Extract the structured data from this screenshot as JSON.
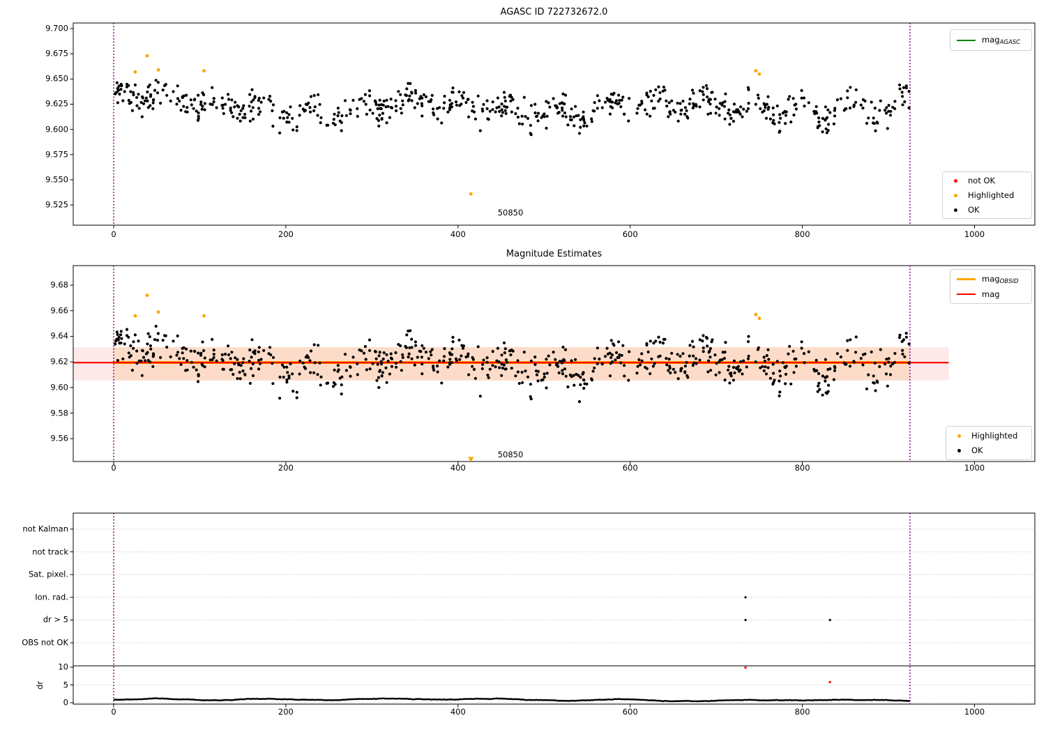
{
  "colors": {
    "ok": "#000000",
    "highlighted": "#ffa500",
    "not_ok": "#ff0000",
    "mag_line": "#ff0000",
    "obsid_line": "#ffa500",
    "agasc_line": "#008000",
    "vline": "#800080",
    "band_outer": "#fde9e9",
    "band_inner": "#fcdcc9",
    "grid": "#b5b5b5"
  },
  "legend1": {
    "line_label": "mag",
    "line_sub": "AGASC",
    "items": [
      {
        "label": "not OK",
        "color": "#ff0000"
      },
      {
        "label": "Highlighted",
        "color": "#ffa500"
      },
      {
        "label": "OK",
        "color": "#000000"
      }
    ]
  },
  "legend2": {
    "line1_label": "mag",
    "line1_sub": "OBSID",
    "line1_color": "#ffa500",
    "line2_label": "mag",
    "line2_color": "#ff0000",
    "items": [
      {
        "label": "Highlighted",
        "color": "#ffa500"
      },
      {
        "label": "OK",
        "color": "#000000"
      }
    ]
  },
  "chart_data": [
    {
      "type": "scatter",
      "title": "AGASC ID 722732672.0",
      "xlabel": "",
      "ylabel": "",
      "xlim": [
        -47,
        1070
      ],
      "ylim": [
        9.505,
        9.706
      ],
      "xticks": [
        0,
        200,
        400,
        600,
        800,
        1000
      ],
      "yticks": [
        "9.700",
        "9.675",
        "9.650",
        "9.625",
        "9.600",
        "9.575",
        "9.550",
        "9.525"
      ],
      "vlines": [
        0,
        925
      ],
      "annotation": {
        "text": "50850",
        "x": 461,
        "y": 9.513
      },
      "legend_line_label": "mag_AGASC",
      "legend_point_labels": [
        "not OK",
        "Highlighted",
        "OK"
      ],
      "highlighted_points": [
        [
          25,
          9.657
        ],
        [
          39,
          9.673
        ],
        [
          52,
          9.659
        ],
        [
          105,
          9.658
        ],
        [
          415,
          9.536
        ],
        [
          746,
          9.658
        ],
        [
          750,
          9.655
        ]
      ],
      "cloud": {
        "seed": 20240914,
        "n": 690,
        "x_min": 1,
        "x_max": 924,
        "mean": 9.621,
        "sigma": 0.0075,
        "wave1": {
          "amp": 0.0075,
          "period": 57,
          "phase": 1.2
        },
        "wave2": {
          "amp": 0.004,
          "period": 300,
          "phase": 0.4
        },
        "start_boost": {
          "amp": 0.013,
          "scale": 75
        },
        "low_tail_prob": 0.02,
        "low_tail": 0.016,
        "clip_lo": 9.586,
        "clip_hi": 9.668
      }
    },
    {
      "type": "scatter",
      "title": "Magnitude Estimates",
      "xlim": [
        -47,
        1070
      ],
      "ylim": [
        9.542,
        9.695
      ],
      "xticks": [
        0,
        200,
        400,
        600,
        800,
        1000
      ],
      "yticks": [
        "9.68",
        "9.66",
        "9.64",
        "9.62",
        "9.60",
        "9.58",
        "9.56"
      ],
      "vlines": [
        0,
        925
      ],
      "mag": 9.6195,
      "mag_band": [
        9.6055,
        9.6315
      ],
      "mag_x": [
        -47,
        970
      ],
      "obsid_x": [
        0,
        925
      ],
      "offset_from_panel1": -0.0025,
      "annotation": {
        "text": "50850",
        "x": 461
      },
      "clipped_marker": {
        "x": 415,
        "direction": "down"
      },
      "legend_line_labels": [
        "mag_OBSID",
        "mag"
      ],
      "legend_point_labels": [
        "Highlighted",
        "OK"
      ],
      "highlighted_points": [
        [
          25,
          9.656
        ],
        [
          39,
          9.672
        ],
        [
          52,
          9.659
        ],
        [
          105,
          9.656
        ],
        [
          746,
          9.657
        ],
        [
          750,
          9.654
        ]
      ]
    },
    {
      "type": "flags_dr",
      "categories": [
        "not Kalman",
        "not track",
        "Sat. pixel.",
        "Ion. rad.",
        "dr > 5",
        "OBS not OK"
      ],
      "xticks": [
        0,
        200,
        400,
        600,
        800,
        1000
      ],
      "dr_ticks": [
        10,
        5,
        0
      ],
      "dr_ylabel": "dr",
      "vlines": [
        0,
        925
      ],
      "grid": "dotted",
      "flag_points": [
        {
          "x": 734,
          "category": "Ion. rad."
        },
        {
          "x": 734,
          "category": "dr > 5"
        },
        {
          "x": 832,
          "category": "dr > 5"
        }
      ],
      "dr_outliers": [
        {
          "x": 734,
          "dr": 9.9
        },
        {
          "x": 832,
          "dr": 5.8
        }
      ],
      "dr_trace": {
        "seed": 9,
        "n": 760,
        "x_min": 1,
        "x_max": 924,
        "base": 0.78,
        "min": 0.25,
        "max": 1.55
      }
    }
  ]
}
